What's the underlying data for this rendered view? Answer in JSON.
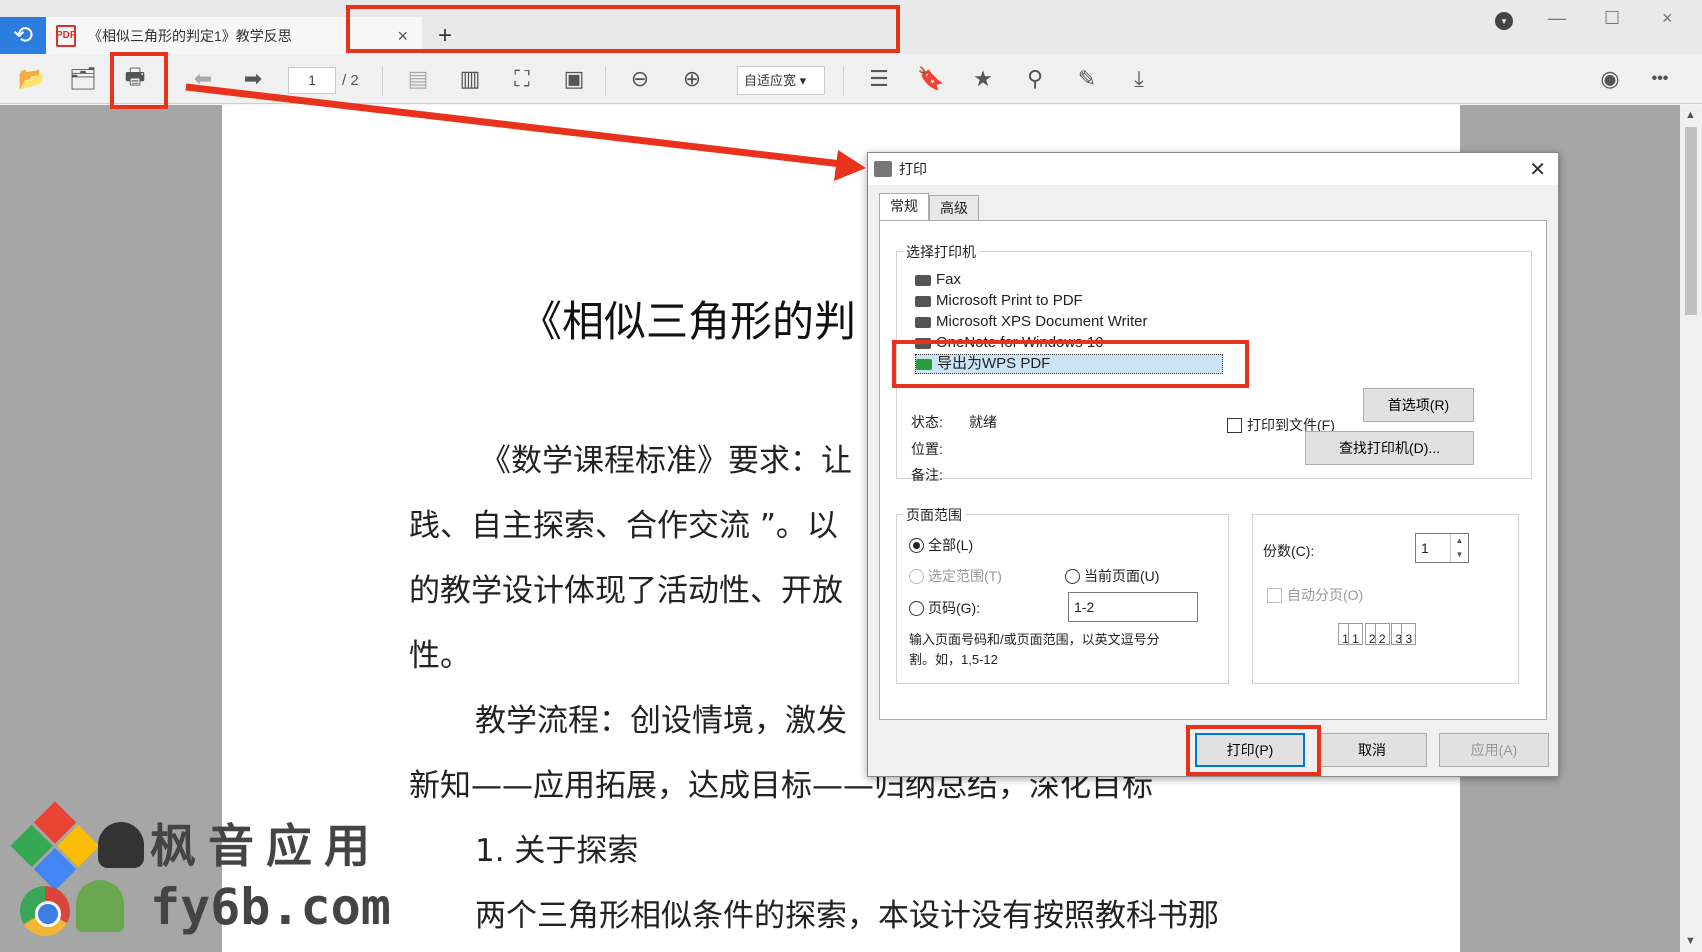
{
  "tab": {
    "title": "《相似三角形的判定1》教学反思",
    "close": "×",
    "new": "+"
  },
  "window": {
    "minimize": "—",
    "maximize": "☐",
    "close": "×"
  },
  "toolbar": {
    "page_current": "1",
    "page_total": "/ 2",
    "zoom": "自适应宽 ▾",
    "more": "•••"
  },
  "document": {
    "title": "《相似三角形的判",
    "lines": [
      "《数学课程标准》要求：让",
      "践、自主探索、合作交流 ”。以",
      "的教学设计体现了活动性、开放",
      "性。",
      "教学流程：创设情境，激发",
      "新知——应用拓展，达成目标——归纳总结，深化目标",
      "1. 关于探索",
      "两个三角形相似条件的探索，本设计没有按照教科书那"
    ]
  },
  "watermark": {
    "line1": "枫音应用",
    "line2": "fy6b.com"
  },
  "dialog": {
    "title": "打印",
    "close": "✕",
    "tabs": [
      "常规",
      "高级"
    ],
    "printer_group_label": "选择打印机",
    "printers": [
      "Fax",
      "Microsoft Print to PDF",
      "Microsoft XPS Document Writer",
      "OneNote for Windows 10",
      "导出为WPS PDF"
    ],
    "status_label": "状态:",
    "status_value": "就绪",
    "location_label": "位置:",
    "comment_label": "备注:",
    "print_to_file": "打印到文件(F)",
    "preferences_button": "首选项(R)",
    "find_printer_button": "查找打印机(D)...",
    "page_range_label": "页面范围",
    "range_all": "全部(L)",
    "range_selection": "选定范围(T)",
    "range_current": "当前页面(U)",
    "range_pages": "页码(G):",
    "pages_value": "1-2",
    "pages_hint_1": "输入页面号码和/或页面范围，以英文逗号分",
    "pages_hint_2": "割。如，1,5-12",
    "copies_label": "份数(C):",
    "copies_value": "1",
    "collate_label": "自动分页(O)",
    "collate_pages": [
      "1",
      "1",
      "2",
      "2",
      "3",
      "3"
    ],
    "print_button": "打印(P)",
    "cancel_button": "取消",
    "apply_button": "应用(A)"
  },
  "colors": {
    "annotation": "#e8321c",
    "accent": "#0078d7",
    "app_blue": "#2b7ee0"
  }
}
